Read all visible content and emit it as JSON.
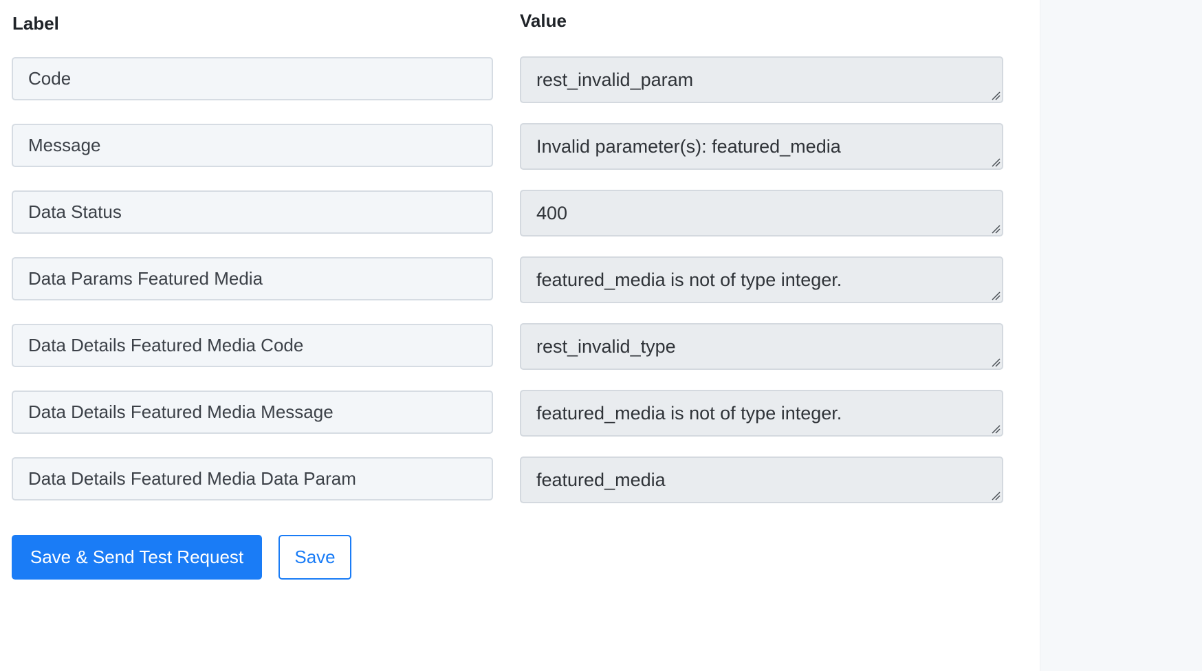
{
  "headers": {
    "label": "Label",
    "value": "Value"
  },
  "rows": [
    {
      "label": "Code",
      "value": "rest_invalid_param"
    },
    {
      "label": "Message",
      "value": "Invalid parameter(s): featured_media"
    },
    {
      "label": "Data Status",
      "value": "400"
    },
    {
      "label": "Data Params Featured Media",
      "value": "featured_media is not of type integer."
    },
    {
      "label": "Data Details Featured Media Code",
      "value": "rest_invalid_type"
    },
    {
      "label": "Data Details Featured Media Message",
      "value": "featured_media is not of type integer."
    },
    {
      "label": "Data Details Featured Media Data Param",
      "value": "featured_media"
    }
  ],
  "actions": {
    "save_and_send_label": "Save & Send Test Request",
    "save_label": "Save"
  },
  "colors": {
    "primary": "#1a7cf6",
    "label_field_bg": "#f3f6f9",
    "value_field_bg": "#e9ecef"
  }
}
